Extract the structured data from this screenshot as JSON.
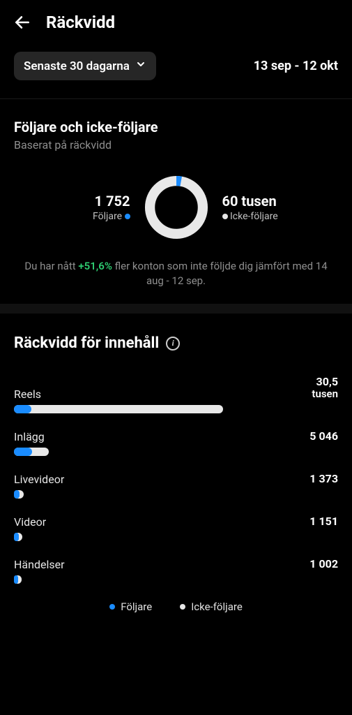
{
  "header": {
    "title": "Räckvidd"
  },
  "filter": {
    "chip_label": "Senaste 30 dagarna",
    "date_range": "13 sep - 12 okt"
  },
  "audience": {
    "title": "Följare och icke-följare",
    "subtitle": "Baserat på räckvidd",
    "followers_value": "1 752",
    "followers_label": "Följare",
    "nonfollowers_value": "60 tusen",
    "nonfollowers_label": "Icke-följare",
    "note_prefix": "Du har nått ",
    "note_delta": "+51,6%",
    "note_suffix": " fler konton som inte följde dig jämfört med 14 aug - 12 sep."
  },
  "content_reach": {
    "title": "Räckvidd för innehåll",
    "rows": [
      {
        "label": "Reels",
        "value": "30,5",
        "unit": "tusen"
      },
      {
        "label": "Inlägg",
        "value": "5 046"
      },
      {
        "label": "Livevideor",
        "value": "1 373"
      },
      {
        "label": "Videor",
        "value": "1 151"
      },
      {
        "label": "Händelser",
        "value": "1 002"
      }
    ],
    "legend": {
      "followers": "Följare",
      "nonfollowers": "Icke-följare"
    }
  },
  "colors": {
    "accent_blue": "#1a8cff",
    "accent_white": "#e8e8e8",
    "positive": "#2ecc71"
  },
  "chart_data": [
    {
      "type": "pie",
      "title": "Följare och icke-följare",
      "series": [
        {
          "name": "Följare",
          "value": 1752
        },
        {
          "name": "Icke-följare",
          "value": 60000
        }
      ]
    },
    {
      "type": "bar",
      "title": "Räckvidd för innehåll",
      "categories": [
        "Reels",
        "Inlägg",
        "Livevideor",
        "Videor",
        "Händelser"
      ],
      "series": [
        {
          "name": "Följare",
          "values": [
            1600,
            2400,
            650,
            550,
            480
          ]
        },
        {
          "name": "Icke-följare",
          "values": [
            28900,
            2646,
            723,
            601,
            522
          ]
        }
      ],
      "totals": [
        30500,
        5046,
        1373,
        1151,
        1002
      ],
      "xlabel": "",
      "ylabel": "Räckvidd"
    }
  ]
}
